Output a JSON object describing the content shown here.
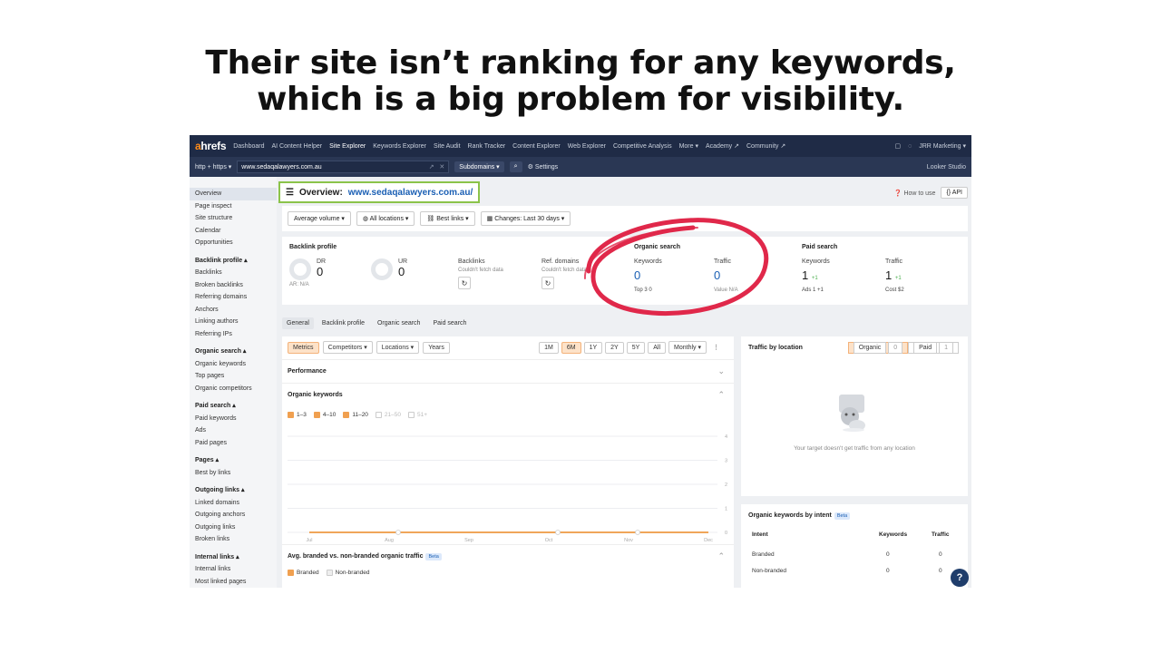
{
  "slide": {
    "line1": "Their site isn’t ranking for any keywords,",
    "line2": "which is a big problem for visibility."
  },
  "topnav": {
    "logo_a": "a",
    "logo_rest": "hrefs",
    "items": [
      "Dashboard",
      "AI Content Helper",
      "Site Explorer",
      "Keywords Explorer",
      "Site Audit",
      "Rank Tracker",
      "Content Explorer",
      "Web Explorer",
      "Competitive Analysis",
      "More ▾",
      "Academy ↗",
      "Community ↗"
    ],
    "account": "JRR Marketing ▾"
  },
  "urlbar": {
    "protocol": "http + https ▾",
    "url": "www.sedaqalawyers.com.au",
    "mode": "Subdomains ▾",
    "search_icon": "search-icon",
    "settings": "Settings",
    "looker": "Looker Studio"
  },
  "sidebar": {
    "top": [
      "Overview",
      "Page inspect",
      "Site structure",
      "Calendar",
      "Opportunities"
    ],
    "sections": [
      {
        "head": "Backlink profile ▴",
        "items": [
          "Backlinks",
          "Broken backlinks",
          "Referring domains",
          "Anchors",
          "Linking authors",
          "Referring IPs"
        ]
      },
      {
        "head": "Organic search ▴",
        "items": [
          "Organic keywords",
          "Top pages",
          "Organic competitors"
        ]
      },
      {
        "head": "Paid search ▴",
        "items": [
          "Paid keywords",
          "Ads",
          "Paid pages"
        ]
      },
      {
        "head": "Pages ▴",
        "items": [
          "Best by links"
        ]
      },
      {
        "head": "Outgoing links ▴",
        "items": [
          "Linked domains",
          "Outgoing anchors",
          "Outgoing links",
          "Broken links"
        ]
      },
      {
        "head": "Internal links ▴",
        "items": [
          "Internal links",
          "Most linked pages"
        ]
      }
    ]
  },
  "overview": {
    "prefix": "Overview:",
    "url": "www.sedaqalawyers.com.au/",
    "how_to_use": "How to use",
    "api": "{} API"
  },
  "filters": [
    "Average volume ▾",
    "All locations ▾",
    "Best links ▾",
    "Changes: Last 30 days ▾"
  ],
  "metrics": {
    "backlink_profile": "Backlink profile",
    "dr_label": "DR",
    "dr_value": "0",
    "ar": "AR: N/A",
    "ur_label": "UR",
    "ur_value": "0",
    "backlinks_label": "Backlinks",
    "backlinks_sub": "Couldn't fetch data",
    "refdomains_label": "Ref. domains",
    "refdomains_sub": "Couldn't fetch data",
    "organic_search": "Organic search",
    "org_keywords_label": "Keywords",
    "org_keywords_value": "0",
    "top3": "Top 3  0",
    "org_traffic_label": "Traffic",
    "org_traffic_value": "0",
    "value": "Value  N/A",
    "paid_search": "Paid search",
    "paid_keywords_label": "Keywords",
    "paid_keywords_value": "1",
    "paid_keywords_delta": "+1",
    "ads": "Ads  1  +1",
    "paid_traffic_label": "Traffic",
    "paid_traffic_value": "1",
    "paid_traffic_delta": "+1",
    "cost": "Cost  $2"
  },
  "tabs": [
    "General",
    "Backlink profile",
    "Organic search",
    "Paid search"
  ],
  "chart_card": {
    "chips": [
      "Metrics",
      "Competitors ▾",
      "Locations ▾",
      "Years"
    ],
    "ranges": [
      "1M",
      "6M",
      "1Y",
      "2Y",
      "5Y",
      "All",
      "Monthly ▾",
      "⋮"
    ],
    "performance": "Performance",
    "organic_keywords": "Organic keywords",
    "legend": [
      "1–3",
      "4–10",
      "11–20",
      "21–50",
      "51+"
    ],
    "avg_branded": "Avg. branded vs. non-branded organic traffic",
    "beta": "Beta",
    "branded": "Branded",
    "non_branded": "Non-branded"
  },
  "chart_data": {
    "type": "line",
    "categories": [
      "Jul",
      "Aug",
      "Sep",
      "Oct",
      "Nov",
      "Dec"
    ],
    "series": [
      {
        "name": "1–3",
        "values": [
          0,
          0,
          0,
          0,
          0,
          0
        ]
      },
      {
        "name": "4–10",
        "values": [
          0,
          0,
          0,
          0,
          0,
          0
        ]
      },
      {
        "name": "11–20",
        "values": [
          0,
          0,
          0,
          0,
          0,
          0
        ]
      }
    ],
    "ylim": [
      0,
      4
    ],
    "yticks": [
      "4",
      "3",
      "2",
      "1",
      "0"
    ],
    "grid": true,
    "color": "#f0a050"
  },
  "side_card": {
    "title": "Traffic by location",
    "organic": "Organic",
    "organic_count": "0",
    "paid": "Paid",
    "paid_count": "1",
    "empty": "Your target doesn't get traffic from any location"
  },
  "intent_card": {
    "title": "Organic keywords by intent",
    "beta": "Beta",
    "headers": [
      "Intent",
      "Keywords",
      "Traffic"
    ],
    "rows": [
      [
        "Branded",
        "0",
        "0"
      ],
      [
        "Non-branded",
        "0",
        "0"
      ]
    ]
  },
  "help": "?",
  "colors": {
    "nav": "#1f2b46",
    "accent": "#f0a050",
    "highlight_ring": "#e0284a",
    "overview_box": "#8bc34a"
  }
}
